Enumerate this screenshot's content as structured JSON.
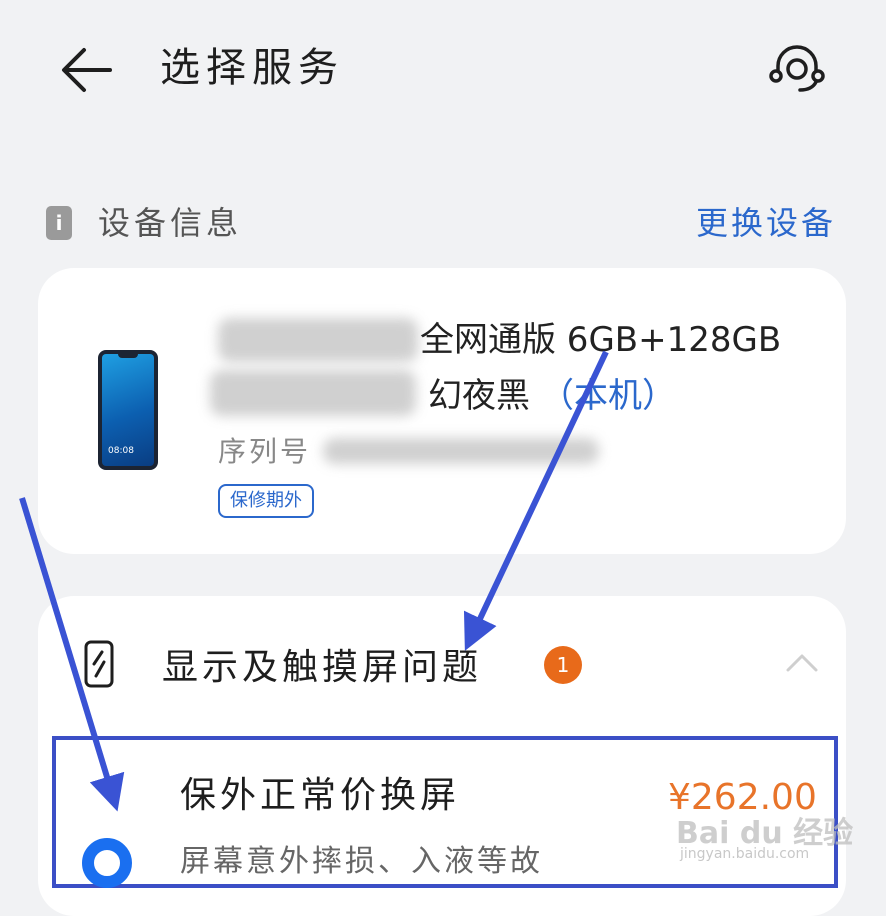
{
  "header": {
    "back_icon": "back-arrow-icon",
    "title": "选择服务",
    "support_icon": "headset-icon"
  },
  "device_section": {
    "icon": "info-icon",
    "icon_glyph": "i",
    "label": "设备信息",
    "change_label": "更换设备"
  },
  "device": {
    "image_icon": "phone-icon",
    "phone_time": "08:08",
    "model_line1": "全网通版 6GB+128GB",
    "model_line2": "幻夜黑",
    "this_device": "（本机）",
    "serial_label": "序列号",
    "warranty": "保修期外"
  },
  "problem": {
    "icon": "phone-screen-icon",
    "category": "显示及触摸屏问题",
    "count": "1",
    "collapse_icon": "chevron-up-icon"
  },
  "option": {
    "title": "保外正常价换屏",
    "description": "屏幕意外摔损、入液等故",
    "price": "¥262.00",
    "selected": true
  },
  "watermark": {
    "text": "Bai du 经验",
    "sub": "jingyan.baidu.com"
  },
  "colors": {
    "accent_blue": "#2b68cc",
    "badge_orange": "#e86a1a",
    "price_orange": "#e8742a",
    "highlight_frame": "#3b4fc6",
    "background": "#f1f2f4"
  }
}
